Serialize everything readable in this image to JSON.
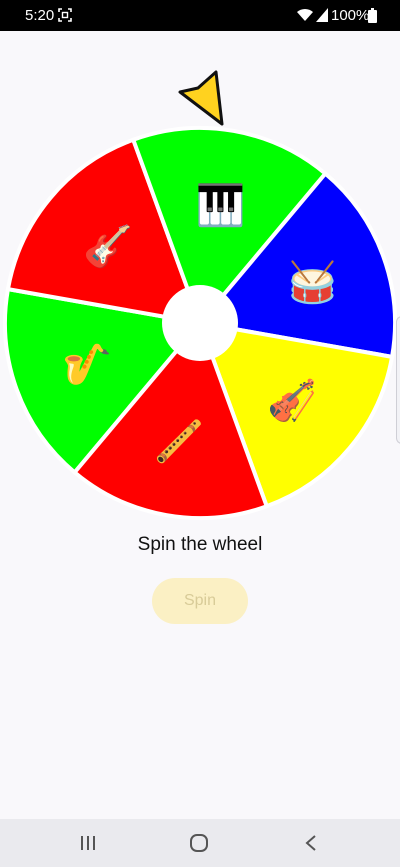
{
  "status_bar": {
    "time": "5:20",
    "battery": "100%",
    "icons": [
      "screenshot-icon",
      "wifi-icon",
      "signal-icon",
      "battery-icon"
    ]
  },
  "wheel": {
    "pointer_color": "#ffd21f",
    "segments": [
      {
        "color": "#00ff00",
        "icon": "saxophone",
        "emoji": "🎷"
      },
      {
        "color": "#ff0000",
        "icon": "guitar",
        "emoji": "🎸"
      },
      {
        "color": "#00ff00",
        "icon": "piano",
        "emoji": "🎹"
      },
      {
        "color": "#0000ff",
        "icon": "drum",
        "emoji": "🥁"
      },
      {
        "color": "#ffff00",
        "icon": "violin",
        "emoji": "🎻"
      },
      {
        "color": "#ff0000",
        "icon": "flute",
        "emoji": "🪈"
      }
    ]
  },
  "caption": "Spin the wheel",
  "spin_button": {
    "label": "Spin"
  },
  "nav_bar": {
    "icons": [
      "recent-apps-icon",
      "home-icon",
      "back-icon"
    ]
  }
}
